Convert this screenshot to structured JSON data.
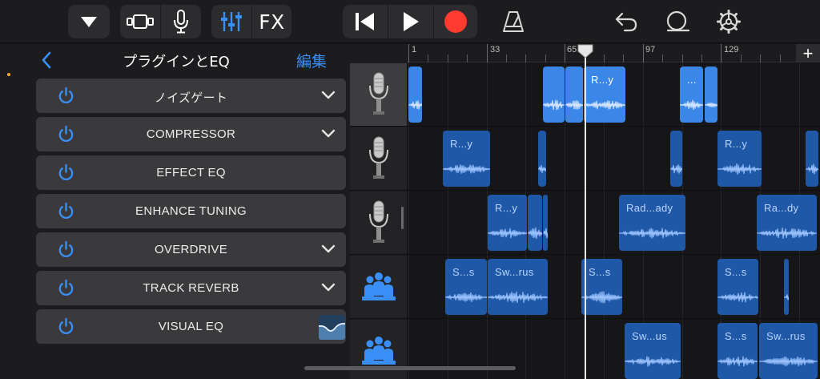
{
  "toolbar": {
    "fx_label": "FX"
  },
  "panel": {
    "title": "プラグインとEQ",
    "edit_label": "編集",
    "plugins": [
      {
        "label": "ノイズゲート",
        "expandable": true
      },
      {
        "label": "COMPRESSOR",
        "expandable": true
      },
      {
        "label": "EFFECT EQ",
        "expandable": false
      },
      {
        "label": "ENHANCE TUNING",
        "expandable": false
      },
      {
        "label": "OVERDRIVE",
        "expandable": true
      },
      {
        "label": "TRACK REVERB",
        "expandable": true
      },
      {
        "label": "VISUAL EQ",
        "expandable": false
      }
    ]
  },
  "ruler": {
    "bar_labels": [
      "1",
      "33",
      "65",
      "97",
      "129"
    ],
    "add_label": "+"
  },
  "tracks": [
    {
      "icon": "microphone-icon",
      "selected": true,
      "regions": [
        {
          "name": "",
          "style": "light"
        },
        {
          "name": "",
          "style": "light"
        },
        {
          "name": "",
          "style": "light"
        },
        {
          "name": "R...y",
          "style": "light"
        },
        {
          "name": "...",
          "style": "light"
        },
        {
          "name": "",
          "style": "light"
        }
      ]
    },
    {
      "icon": "microphone-icon",
      "selected": false,
      "regions": [
        {
          "name": "R...y",
          "style": "dark"
        },
        {
          "name": "",
          "style": "dark"
        },
        {
          "name": "",
          "style": "dark"
        },
        {
          "name": "R...y",
          "style": "dark"
        },
        {
          "name": "",
          "style": "dark"
        }
      ]
    },
    {
      "icon": "microphone-icon",
      "selected": false,
      "regions": [
        {
          "name": "R...y",
          "style": "dark"
        },
        {
          "name": "",
          "style": "dark"
        },
        {
          "name": "",
          "style": "dark"
        },
        {
          "name": "Rad...ady",
          "style": "dark"
        },
        {
          "name": "Ra...dy",
          "style": "dark"
        }
      ]
    },
    {
      "icon": "choir-icon",
      "selected": false,
      "regions": [
        {
          "name": "S...s",
          "style": "dark"
        },
        {
          "name": "Sw...rus",
          "style": "dark"
        },
        {
          "name": "S...s",
          "style": "dark"
        },
        {
          "name": "S...s",
          "style": "dark"
        },
        {
          "name": "",
          "style": "dark"
        }
      ]
    },
    {
      "icon": "choir-icon",
      "selected": false,
      "regions": [
        {
          "name": "Sw...us",
          "style": "dark"
        },
        {
          "name": "S...s",
          "style": "dark"
        },
        {
          "name": "Sw...rus",
          "style": "dark"
        }
      ]
    }
  ]
}
